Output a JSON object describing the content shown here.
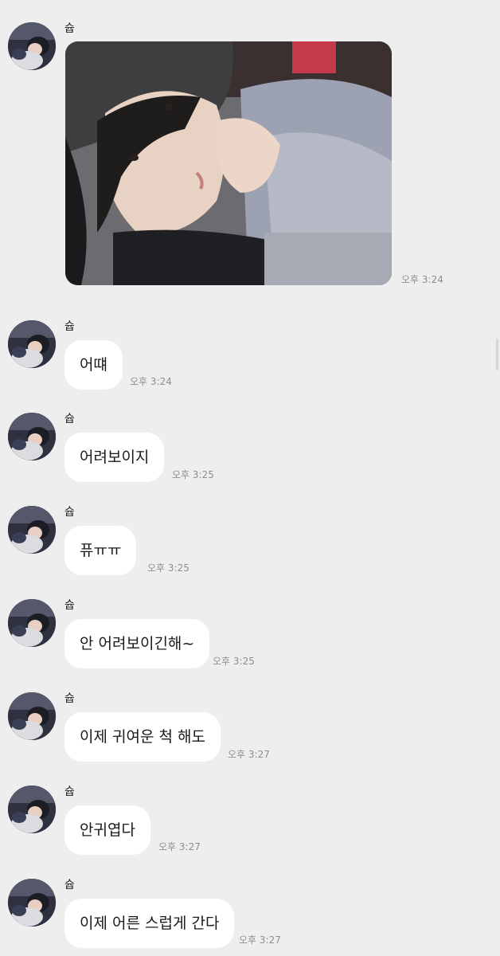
{
  "messages": [
    {
      "sender": "슙",
      "type": "image",
      "time": "오후 3:24"
    },
    {
      "sender": "슙",
      "type": "text",
      "text": "어떄",
      "time": "오후 3:24"
    },
    {
      "sender": "슙",
      "type": "text",
      "text": "어려보이지",
      "time": "오후 3:25"
    },
    {
      "sender": "슙",
      "type": "text",
      "text": "퓨ㅠㅠ",
      "time": "오후 3:25"
    },
    {
      "sender": "슙",
      "type": "text",
      "text": "안 어려보이긴해~",
      "time": "오후 3:25"
    },
    {
      "sender": "슙",
      "type": "text",
      "text": "이제 귀여운 척 해도",
      "time": "오후 3:27"
    },
    {
      "sender": "슙",
      "type": "text",
      "text": "안귀엽다",
      "time": "오후 3:27"
    },
    {
      "sender": "슙",
      "type": "text",
      "text": "이제 어른 스럽게 간다",
      "time": "오후 3:27"
    }
  ],
  "icons": {
    "avatar": "avatar-photo",
    "shared_photo": "photo-thumbnail"
  },
  "colors": {
    "background": "#eeeeee",
    "bubble": "#ffffff",
    "time_text": "#8e8e8e"
  }
}
